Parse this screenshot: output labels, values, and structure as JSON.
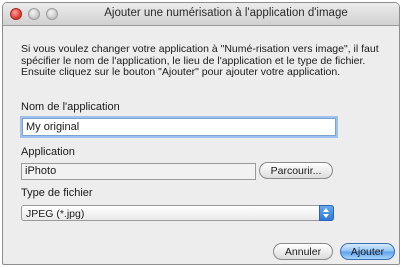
{
  "window": {
    "title": "Ajouter une numérisation à l'application d'image"
  },
  "instructions": "Si vous voulez changer votre application à \"Numé-risation vers image\", il faut spécifier le nom de l'application, le lieu de l'application et le type de fichier. Ensuite cliquez sur le bouton \"Ajouter\" pour ajouter votre application.",
  "app_name": {
    "label": "Nom de l'application",
    "value": "My original"
  },
  "application": {
    "label": "Application",
    "value": "iPhoto",
    "browse_label": "Parcourir..."
  },
  "file_type": {
    "label": "Type de fichier",
    "selected": "JPEG (*.jpg)"
  },
  "buttons": {
    "cancel": "Annuler",
    "add": "Ajouter"
  },
  "colors": {
    "accent": "#5aa1ec",
    "focus_ring": "#9cc1ee"
  }
}
